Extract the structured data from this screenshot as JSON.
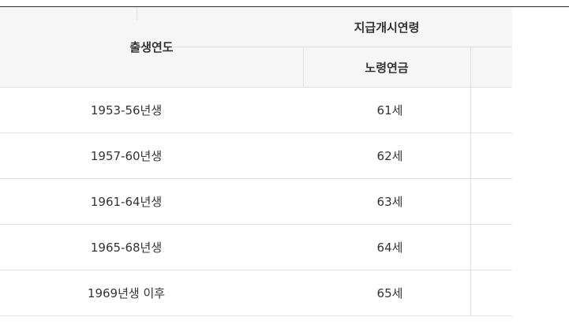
{
  "table": {
    "header": {
      "birth_year": "출생연도",
      "start_age": "지급개시연령",
      "old_age_pension": "노령연금"
    },
    "rows": [
      {
        "birth": "1953-56년생",
        "age": "61세"
      },
      {
        "birth": "1957-60년생",
        "age": "62세"
      },
      {
        "birth": "1961-64년생",
        "age": "63세"
      },
      {
        "birth": "1965-68년생",
        "age": "64세"
      },
      {
        "birth": "1969년생 이후",
        "age": "65세"
      }
    ]
  },
  "colors": {
    "header_bg": "#f6f6f6",
    "border": "#e1e1e1",
    "top_border": "#2b2b2b",
    "text": "#333333"
  }
}
